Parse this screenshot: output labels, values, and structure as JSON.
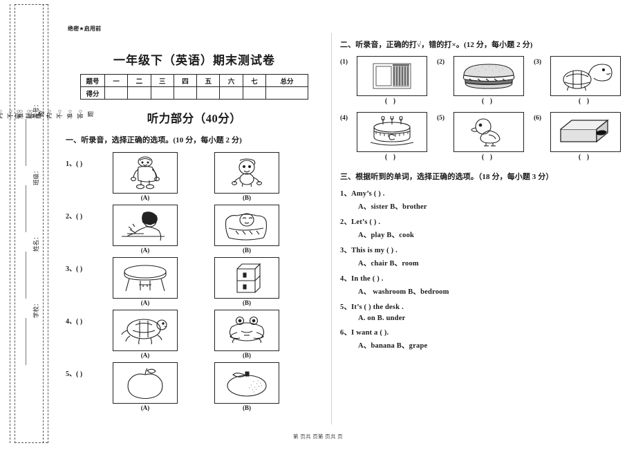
{
  "header": {
    "secret_mark": "绝密★启用前",
    "title": "一年级下（英语）期末测试卷",
    "part_title": "听力部分（40分）"
  },
  "score_table": {
    "row_labels": [
      "题号",
      "得分"
    ],
    "columns": [
      "一",
      "二",
      "三",
      "四",
      "五",
      "六",
      "七",
      "总分"
    ]
  },
  "seal_margin": {
    "strip_text": "密○封○线○内○不○准○答○题",
    "fields": [
      {
        "label": "考号："
      },
      {
        "label": "班级："
      },
      {
        "label": "姓名："
      },
      {
        "label": "学校："
      }
    ]
  },
  "section_one": {
    "heading": "一、听录音，选择正确的选项。(10 分，每小题 2 分)",
    "option_a_label": "(A)",
    "option_b_label": "(B)",
    "questions": [
      {
        "num": "1、(      )",
        "a_icon": "fat-boy-icon",
        "b_icon": "baby-sitting-icon"
      },
      {
        "num": "2、(      )",
        "a_icon": "child-writing-icon",
        "b_icon": "child-sleeping-icon"
      },
      {
        "num": "3、(      )",
        "a_icon": "round-table-icon",
        "b_icon": "cabinet-icon"
      },
      {
        "num": "4、(      )",
        "a_icon": "turtle-icon",
        "b_icon": "frog-icon"
      },
      {
        "num": "5、(      )",
        "a_icon": "apple-icon",
        "b_icon": "orange-icon"
      }
    ]
  },
  "section_two": {
    "heading": "二、听录音，正确的打√，错的打×。(12 分，每小题 2 分)",
    "answer_blank": "(      )",
    "items": [
      {
        "tag": "(1)",
        "icon": "window-curtain-icon"
      },
      {
        "tag": "(2)",
        "icon": "hamburger-icon"
      },
      {
        "tag": "(3)",
        "icon": "turtle-dinosaur-icon"
      },
      {
        "tag": "(4)",
        "icon": "birthday-cake-icon"
      },
      {
        "tag": "(5)",
        "icon": "duck-icon"
      },
      {
        "tag": "(6)",
        "icon": "box-icon"
      }
    ]
  },
  "section_three": {
    "heading": "三、根据听到的单词，选择正确的选项。（18 分，每小题 3 分）",
    "questions": [
      {
        "stem": "1、Amy’s   (      )  .",
        "options": "A、sister  B、brother"
      },
      {
        "stem": "2、Let’s  (      ) .",
        "options": "A、play    B、cook"
      },
      {
        "stem": "3、This is my   (      ) .",
        "options": "A、chair        B、room"
      },
      {
        "stem": "4、In the     (      ) .",
        "options": "A、 washroom   B、bedroom"
      },
      {
        "stem": "5、It’s (      ) the desk .",
        "options": "A. on              B. under"
      },
      {
        "stem": "6、I want a (      ).",
        "options": "A、banana        B、grape"
      }
    ]
  },
  "footer": {
    "text": "第 页共 页第 页共 页"
  }
}
